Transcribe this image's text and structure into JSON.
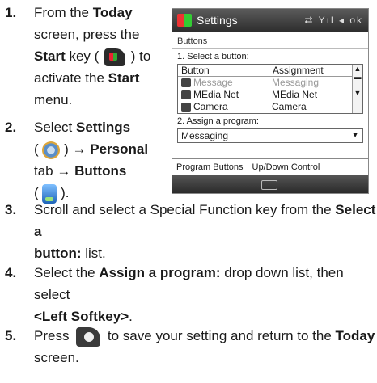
{
  "steps": [
    {
      "num": "1.",
      "lines": [
        [
          "From the ",
          {
            "b": "Today"
          }
        ],
        [
          "screen, press the"
        ],
        [
          {
            "b": "Start"
          },
          " key ( ",
          {
            "icon": "start-key"
          },
          " ) to"
        ],
        [
          "activate the ",
          {
            "b": "Start"
          }
        ],
        [
          "menu."
        ]
      ]
    },
    {
      "num": "2.",
      "lines": [
        [
          "Select ",
          {
            "b": "Settings"
          }
        ],
        [
          "( ",
          {
            "icon": "settings"
          },
          " ) → ",
          {
            "b": "Personal"
          }
        ],
        [
          "tab → ",
          {
            "b": "Buttons"
          }
        ],
        [
          "( ",
          {
            "icon": "buttons"
          },
          " )."
        ]
      ]
    },
    {
      "num": "3.",
      "lines": [
        [
          "Scroll and select a Special Function key from the ",
          {
            "b": "Select a"
          }
        ],
        [
          {
            "b": "button:"
          },
          " list."
        ]
      ]
    },
    {
      "num": "4.",
      "lines": [
        [
          "Select the ",
          {
            "b": "Assign a program:"
          },
          " drop down list, then select"
        ],
        [
          {
            "b": "<Left Softkey>"
          },
          "."
        ]
      ]
    },
    {
      "num": "5.",
      "lines": [
        [
          "Press ",
          {
            "icon": "ok-key"
          },
          " to save your setting and return to the ",
          {
            "b": "Today"
          }
        ],
        [
          "screen."
        ]
      ]
    }
  ],
  "phone": {
    "title": "Settings",
    "status": "⇄ Yıl ◂ ok",
    "subtitle": "Buttons",
    "label1": "1. Select a button:",
    "headers": [
      "Button",
      "Assignment"
    ],
    "rows": [
      [
        "Message",
        "Messaging"
      ],
      [
        "MEdia Net",
        "MEdia Net"
      ],
      [
        "Camera",
        "Camera"
      ]
    ],
    "label2": "2. Assign a program:",
    "dropdown": "Messaging",
    "tabs": [
      "Program Buttons",
      "Up/Down Control"
    ]
  }
}
